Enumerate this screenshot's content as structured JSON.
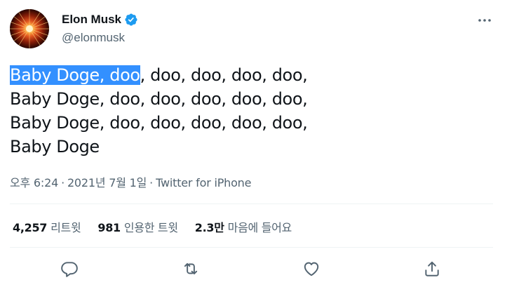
{
  "author": {
    "display_name": "Elon Musk",
    "handle": "@elonmusk",
    "verified": true,
    "avatar_icon": "avatar-image",
    "verified_icon": "verified-badge-icon"
  },
  "menu": {
    "more_icon": "more-options-icon"
  },
  "tweet": {
    "selected_text": "Baby Doge, doo",
    "line1_rest": ", doo, doo, doo, doo,",
    "line2": "Baby Doge, doo, doo, doo, doo, doo,",
    "line3": "Baby Doge, doo, doo, doo, doo, doo,",
    "line4": "Baby Doge"
  },
  "meta": {
    "time": "오후 6:24",
    "separator": "·",
    "date": "2021년 7월 1일",
    "source": "Twitter for iPhone"
  },
  "stats": {
    "retweets": {
      "count": "4,257",
      "label": "리트윗"
    },
    "quotes": {
      "count": "981",
      "label": "인용한 트윗"
    },
    "likes": {
      "count": "2.3만",
      "label": "마음에 들어요"
    }
  },
  "actions": [
    {
      "name": "reply",
      "icon": "reply-icon"
    },
    {
      "name": "retweet",
      "icon": "retweet-icon"
    },
    {
      "name": "like",
      "icon": "like-icon"
    },
    {
      "name": "share",
      "icon": "share-icon"
    }
  ],
  "colors": {
    "text": "#0f1419",
    "secondary": "#536471",
    "divider": "#eff3f4",
    "verified": "#1d9bf0",
    "selection": "#3390ff"
  }
}
